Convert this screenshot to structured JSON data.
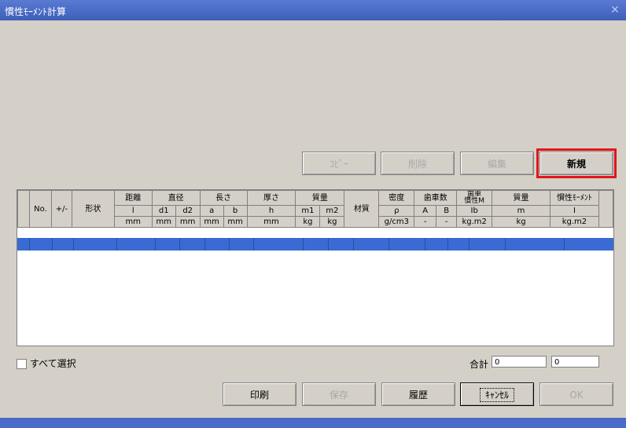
{
  "window": {
    "title": "慣性ﾓｰﾒﾝﾄ計算",
    "close_icon": "close-icon"
  },
  "toolbar": {
    "copy": "ｺﾋﾟｰ",
    "delete": "削除",
    "edit": "編集",
    "new": "新規"
  },
  "grid": {
    "headers": {
      "no": "No.",
      "plus_minus": "+/-",
      "shape": "形状",
      "distance": "距離",
      "diameter": "直径",
      "length": "長さ",
      "thickness": "厚さ",
      "mass": "質量",
      "material": "材質",
      "density": "密度",
      "teeth": "歯車数",
      "gear_inertia": "歯車\n慣性M",
      "mass2": "質量",
      "inertia": "慣性ﾓｰﾒﾝﾄ"
    },
    "symbols": {
      "l": "l",
      "d1": "d1",
      "d2": "d2",
      "a": "a",
      "b": "b",
      "h": "h",
      "m1": "m1",
      "m2": "m2",
      "rho": "ρ",
      "A": "A",
      "B": "B",
      "Ib": "Ib",
      "m": "m",
      "I": "I"
    },
    "units": {
      "l": "mm",
      "d1": "mm",
      "d2": "mm",
      "a": "mm",
      "b": "mm",
      "h": "mm",
      "m1": "kg",
      "m2": "kg",
      "rho": "g/cm3",
      "A": "-",
      "B": "-",
      "Ib": "kg.m2",
      "m": "kg",
      "I": "kg.m2"
    }
  },
  "select_all": "すべて選択",
  "total": {
    "label": "合計",
    "mass": "0",
    "inertia": "0"
  },
  "footer": {
    "print": "印刷",
    "save": "保存",
    "history": "履歴",
    "cancel": "ｷｬﾝｾﾙ",
    "ok": "OK"
  }
}
